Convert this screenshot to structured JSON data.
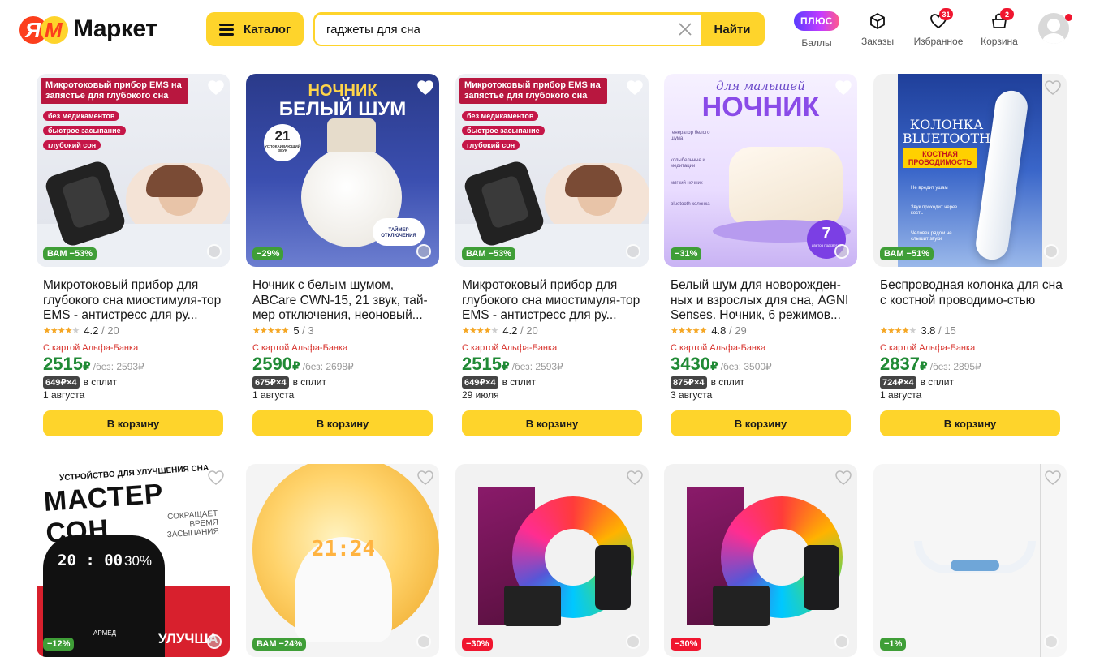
{
  "header": {
    "logo_text": "Маркет",
    "catalog_label": "Каталог",
    "search": {
      "value": "гаджеты для сна",
      "button": "Найти"
    },
    "nav": [
      {
        "key": "plus",
        "pill": "ПЛЮС",
        "label": "Баллы"
      },
      {
        "key": "orders",
        "label": "Заказы"
      },
      {
        "key": "favorites",
        "label": "Избранное",
        "badge": "31"
      },
      {
        "key": "cart",
        "label": "Корзина",
        "badge": "2"
      }
    ]
  },
  "colors": {
    "accent_yellow": "#fed42b",
    "price_green": "#208a35",
    "discount_green": "#3f9e37",
    "discount_red": "#f0162f",
    "alfa_red": "#d7312b"
  },
  "products": [
    {
      "title": "Микротоковый прибор для глубокого сна миостимуля-тор EMS - антистресс для ру...",
      "discount": "ВАМ −53%",
      "rating": "4.2",
      "reviews": "20",
      "stars": 4,
      "alfa": "С картой Альфа-Банка",
      "price": "2515",
      "currency": "₽",
      "old_price": "/без: 2593₽",
      "split": "649₽×4",
      "split_label": "в сплит",
      "delivery": "1 августа",
      "cart": "В корзину"
    },
    {
      "title": "Ночник с белым шумом, ABCare CWN-15, 21 звук, тай-мер отключения, неоновый...",
      "discount": "−29%",
      "rating": "5",
      "reviews": "3",
      "stars": 5,
      "alfa": "С картой Альфа-Банка",
      "price": "2590",
      "currency": "₽",
      "old_price": "/без: 2698₽",
      "split": "675₽×4",
      "split_label": "в сплит",
      "delivery": "1 августа",
      "cart": "В корзину"
    },
    {
      "title": "Микротоковый прибор для глубокого сна миостимуля-тор EMS - антистресс для ру...",
      "discount": "ВАМ −53%",
      "rating": "4.2",
      "reviews": "20",
      "stars": 4,
      "alfa": "С картой Альфа-Банка",
      "price": "2515",
      "currency": "₽",
      "old_price": "/без: 2593₽",
      "split": "649₽×4",
      "split_label": "в сплит",
      "delivery": "29 июля",
      "cart": "В корзину"
    },
    {
      "title": "Белый шум для новорожден-ных и взрослых для сна, AGNI Senses. Ночник, 6 режимов...",
      "discount": "−31%",
      "rating": "4.8",
      "reviews": "29",
      "stars": 5,
      "alfa": "С картой Альфа-Банка",
      "price": "3430",
      "currency": "₽",
      "old_price": "/без: 3500₽",
      "split": "875₽×4",
      "split_label": "в сплит",
      "delivery": "3 августа",
      "cart": "В корзину"
    },
    {
      "title": "Беспроводная колонка для сна с костной проводимо-стью",
      "discount": "ВАМ −51%",
      "rating": "3.8",
      "reviews": "15",
      "stars": 4,
      "alfa": "С картой Альфа-Банка",
      "price": "2837",
      "currency": "₽",
      "old_price": "/без: 2895₽",
      "split": "724₽×4",
      "split_label": "в сплит",
      "delivery": "1 августа",
      "cart": "В корзину"
    }
  ],
  "row2": [
    {
      "discount": "−12%"
    },
    {
      "discount": "ВАМ −24%"
    },
    {
      "discount": "−30%"
    },
    {
      "discount": "−30%"
    },
    {
      "discount": "−1%"
    }
  ],
  "art": {
    "ems_banner": "Микротоковый прибор EMS на запястье для глубокого сна",
    "ems_pills": [
      "без медикаментов",
      "быстрое засыпание",
      "глубокий сон"
    ],
    "night_title1": "НОЧНИК",
    "night_title2": "БЕЛЫЙ ШУМ",
    "night_21": "21",
    "night_21_sub": "УСПОКАИВАЮЩИЙ ЗВУК",
    "night_timer": "ТАЙМЕР ОТКЛЮЧЕНИЯ",
    "baby_script": "для малышей",
    "baby_title": "НОЧНИК",
    "baby_features": [
      "генератор белого шума",
      "колыбельные и медитации",
      "мягкий ночник",
      "bluetooth колонка"
    ],
    "baby_seven": "7",
    "baby_seven_sub": "цветов подсветки",
    "speaker_title": "КОЛОНКА BLUETOOTH",
    "speaker_badge": "КОСТНАЯ ПРОВОДИМОСТЬ",
    "speaker_features": [
      "Не вредит ушам",
      "Звук проходит через кость",
      "Человек рядом не слышит звуки"
    ],
    "master_top": "УСТРОЙСТВО ДЛЯ УЛУЧШЕНИЯ СНА",
    "master_title": "МАСТЕР СОН",
    "master_side": "СОКРАЩАЕТ ВРЕМЯ ЗАСЫПАНИЯ",
    "master_time": "20 : 00",
    "master_pct": "30%",
    "master_brand": "АРМЕД",
    "master_bottom": "УЛУЧША",
    "clock_time": "21:24"
  }
}
